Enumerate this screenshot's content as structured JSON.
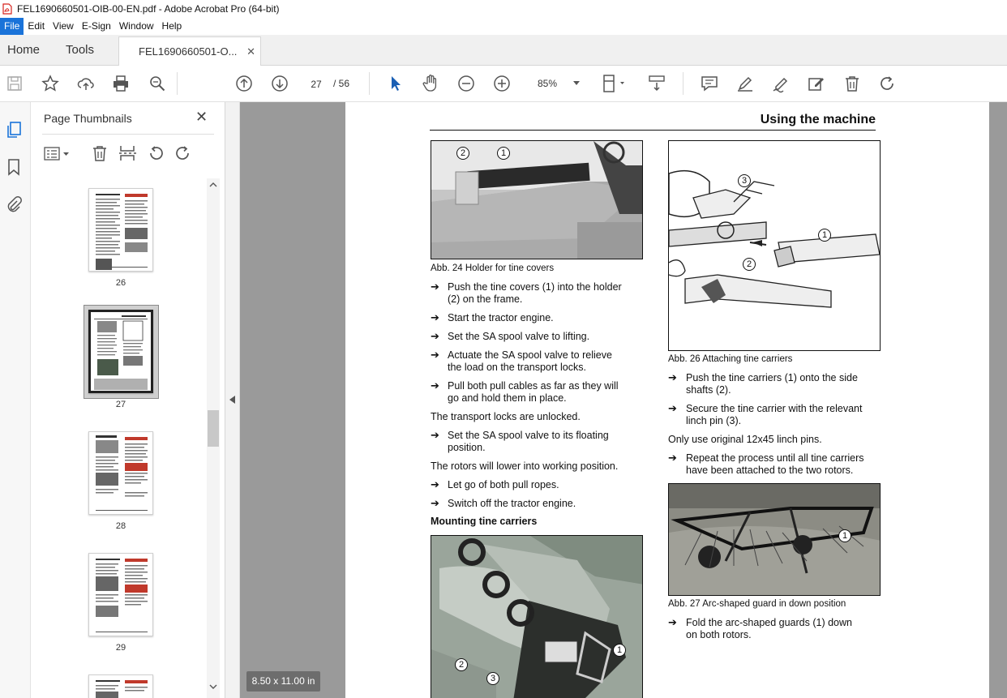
{
  "window": {
    "title": "FEL1690660501-OIB-00-EN.pdf - Adobe Acrobat Pro (64-bit)"
  },
  "menu": [
    "File",
    "Edit",
    "View",
    "E-Sign",
    "Window",
    "Help"
  ],
  "tabs": {
    "home": "Home",
    "tools": "Tools",
    "document": "FEL1690660501-O...",
    "close": "✕"
  },
  "toolbar": {
    "current_page": "27",
    "page_total": "/ 56",
    "zoom": "85%"
  },
  "thumbnails": {
    "title": "Page Thumbnails",
    "close": "✕",
    "pages": [
      "26",
      "27",
      "28",
      "29"
    ],
    "selected": "27"
  },
  "page_size": "8.50 x 11.00 in",
  "pdf": {
    "header": "Using the machine",
    "fig24_caption": "Abb. 24   Holder for tine covers",
    "left_steps_1": [
      [
        "Push the tine covers (1) into the holder",
        "(2) on the frame."
      ],
      [
        "Start the tractor engine."
      ],
      [
        "Set the SA spool valve to lifting."
      ],
      [
        "Actuate the SA spool valve to relieve",
        "the load on the transport locks."
      ],
      [
        "Pull both pull cables as far as they will",
        "go and hold them in place."
      ]
    ],
    "left_note_1": "The transport locks are unlocked.",
    "left_steps_2": [
      [
        "Set the SA spool valve to its floating",
        "position."
      ]
    ],
    "left_note_2": "The rotors will lower into working position.",
    "left_steps_3": [
      [
        "Let go of both pull ropes."
      ],
      [
        "Switch off the tractor engine."
      ]
    ],
    "subheading": "Mounting tine carriers",
    "fig26_caption": "Abb. 26   Attaching tine carriers",
    "right_steps_1": [
      [
        "Push the tine carriers (1) onto the side",
        "shafts (2)."
      ],
      [
        "Secure the tine carrier with the relevant",
        "linch pin (3)."
      ]
    ],
    "right_note": "Only use original 12x45 linch pins.",
    "right_steps_2": [
      [
        "Repeat the process until all tine carriers",
        "have been attached to the two rotors."
      ]
    ],
    "fig27_caption": "Abb. 27   Arc-shaped guard in down position",
    "right_steps_3": [
      [
        "Fold the arc-shaped guards (1) down",
        "on both rotors."
      ]
    ],
    "callouts": {
      "one": "1",
      "two": "2",
      "three": "3"
    }
  },
  "colors": {
    "accent": "#1a73d9",
    "pdf_red": "#d6221c",
    "doc_bg": "#9a9a9a"
  }
}
